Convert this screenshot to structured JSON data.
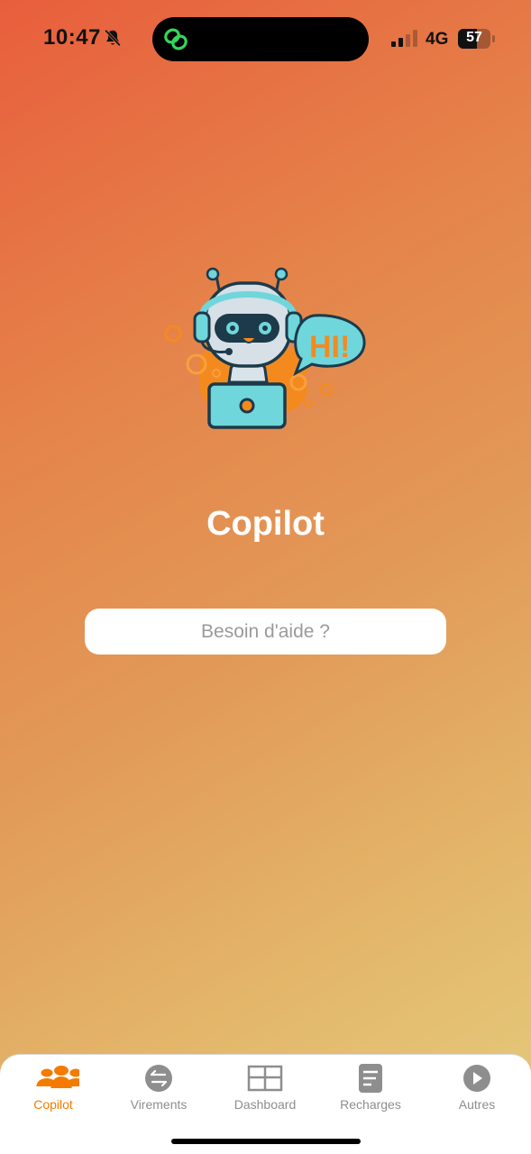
{
  "status_bar": {
    "time": "10:47",
    "network": "4G",
    "battery_level": "57",
    "battery_fraction": 0.57,
    "signal_bars": 2,
    "signal_bars_total": 4,
    "icons": [
      "bell-slash-icon",
      "link-icon",
      "signal-icon",
      "battery-icon"
    ]
  },
  "main": {
    "title": "Copilot",
    "mascot_text": "HI!",
    "search_placeholder": "Besoin d'aide ?",
    "search_value": ""
  },
  "tabbar": {
    "tabs": [
      {
        "label": "Copilot",
        "icon": "people-icon",
        "active": true
      },
      {
        "label": "Virements",
        "icon": "transfer-icon",
        "active": false
      },
      {
        "label": "Dashboard",
        "icon": "grid-icon",
        "active": false
      },
      {
        "label": "Recharges",
        "icon": "document-icon",
        "active": false
      },
      {
        "label": "Autres",
        "icon": "play-icon",
        "active": false
      }
    ],
    "active_color": "#f47b00",
    "inactive_color": "#8e8e8e"
  },
  "colors": {
    "gradient_start": "#e85e3c",
    "gradient_end": "#e5cb7c",
    "robot_teal": "#6fd6dc",
    "robot_outline": "#1d3a4a"
  }
}
